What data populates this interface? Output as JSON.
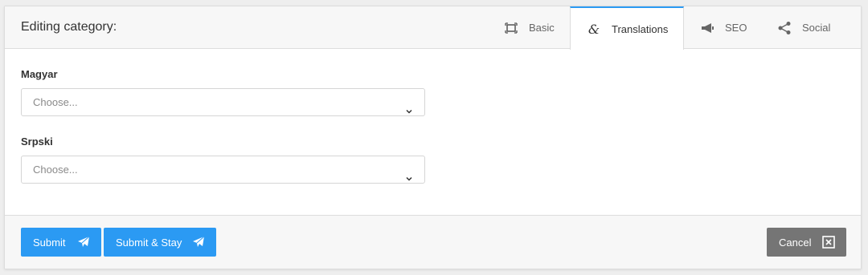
{
  "header": {
    "title": "Editing category:"
  },
  "tabs": [
    {
      "label": "Basic",
      "icon": "frame-icon",
      "active": false
    },
    {
      "label": "Translations",
      "icon": "ampersand-icon",
      "active": true
    },
    {
      "label": "SEO",
      "icon": "megaphone-icon",
      "active": false
    },
    {
      "label": "Social",
      "icon": "share-icon",
      "active": false
    }
  ],
  "ampersand_glyph": "&",
  "fields": [
    {
      "label": "Magyar",
      "placeholder": "Choose..."
    },
    {
      "label": "Srpski",
      "placeholder": "Choose..."
    }
  ],
  "footer": {
    "submit_label": "Submit",
    "submit_stay_label": "Submit & Stay",
    "cancel_label": "Cancel"
  },
  "colors": {
    "accent": "#2b9af3",
    "cancel": "#757575"
  }
}
